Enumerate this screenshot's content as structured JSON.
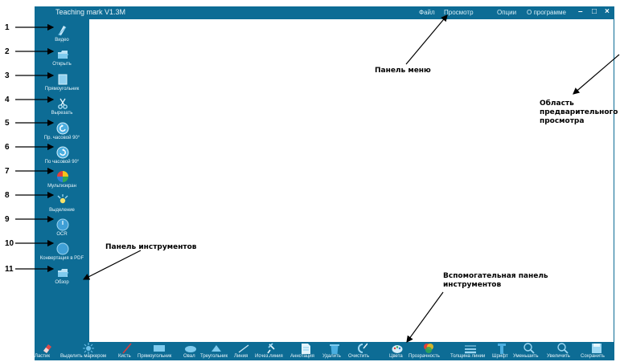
{
  "window": {
    "title": "Teaching mark V1.3M",
    "menu": [
      "Файл",
      "Просмотр",
      "Опции",
      "О программе"
    ],
    "controls": {
      "minimize": "–",
      "maximize": "□",
      "close": "×"
    }
  },
  "sidebar": {
    "items": [
      {
        "label": "Видео",
        "icon": "video-icon"
      },
      {
        "label": "Открыть",
        "icon": "folder-icon"
      },
      {
        "label": "Прямоугольник",
        "icon": "rectangle-icon"
      },
      {
        "label": "Вырезать",
        "icon": "scissors-icon"
      },
      {
        "label": "Пр. часовой 90°",
        "icon": "rotate-ccw-icon"
      },
      {
        "label": "По часовой 90°",
        "icon": "rotate-cw-icon"
      },
      {
        "label": "Мультиэкран",
        "icon": "multiscreen-icon"
      },
      {
        "label": "Выделение",
        "icon": "highlight-icon"
      },
      {
        "label": "OCR",
        "icon": "ocr-icon"
      },
      {
        "label": "Конвертация в PDF",
        "icon": "pdf-icon"
      },
      {
        "label": "Обзор",
        "icon": "browse-icon"
      }
    ]
  },
  "toolbar": {
    "items": [
      {
        "label": "Ластик",
        "icon": "eraser-icon"
      },
      {
        "label": "Выделить маркером",
        "icon": "marker-icon"
      },
      {
        "label": "Кисть",
        "icon": "brush-icon"
      },
      {
        "label": "Прямоугольник",
        "icon": "rectangle-icon"
      },
      {
        "label": "Овал",
        "icon": "oval-icon"
      },
      {
        "label": "Треугольник",
        "icon": "triangle-icon"
      },
      {
        "label": "Линия",
        "icon": "line-icon"
      },
      {
        "label": "Исчез.линия",
        "icon": "fading-line-icon"
      },
      {
        "label": "Аннотация",
        "icon": "annotation-icon"
      },
      {
        "label": "Удалить",
        "icon": "trash-icon"
      },
      {
        "label": "Очистить",
        "icon": "clear-icon"
      },
      {
        "label": "Цвета",
        "icon": "palette-icon"
      },
      {
        "label": "Прозрачность",
        "icon": "transparency-icon"
      },
      {
        "label": "Толщина линии",
        "icon": "line-width-icon"
      },
      {
        "label": "Шрифт",
        "icon": "font-icon"
      },
      {
        "label": "Уменьшить",
        "icon": "zoom-out-icon"
      },
      {
        "label": "Увеличить",
        "icon": "zoom-in-icon"
      },
      {
        "label": "Сохранить",
        "icon": "save-icon"
      }
    ]
  },
  "annotations": {
    "numbers": [
      "1",
      "2",
      "3",
      "4",
      "5",
      "6",
      "7",
      "8",
      "9",
      "10",
      "11"
    ],
    "menu_panel": "Панель меню",
    "preview_area": "Область\nпредварительного\nпросмотра",
    "tools_panel": "Панель инструментов",
    "aux_panel": "Вспомогательная панель\nинструментов"
  },
  "colors": {
    "frame": "#0d6c95",
    "preview": "#ffffff",
    "icon_accent": "#6ec1ea"
  }
}
